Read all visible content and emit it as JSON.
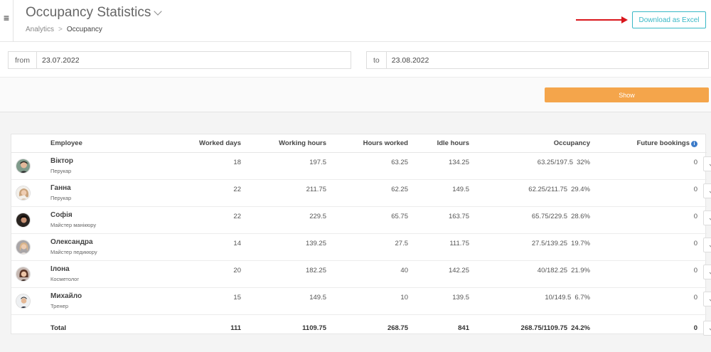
{
  "header": {
    "menu_icon": "hamburger-menu-icon",
    "title": "Occupancy Statistics",
    "breadcrumb": [
      "Analytics",
      "Occupancy"
    ],
    "download_label": "Download as Excel",
    "annotation_arrow_color": "#d9161c"
  },
  "filters": {
    "from_label": "from",
    "from_value": "23.07.2022",
    "to_label": "to",
    "to_value": "23.08.2022",
    "show_label": "Show",
    "accent_color": "#f4a54b"
  },
  "table": {
    "columns": {
      "employee": "Employee",
      "worked_days": "Worked days",
      "working_hours": "Working hours",
      "hours_worked": "Hours worked",
      "idle_hours": "Idle hours",
      "occupancy": "Occupancy",
      "future_bookings": "Future bookings"
    },
    "rows": [
      {
        "name": "Віктор",
        "role": "Перукар",
        "worked_days": "18",
        "working_hours": "197.5",
        "hours_worked": "63.25",
        "idle_hours": "134.25",
        "occupancy": "63.25/197.5",
        "occupancy_pct": "32%",
        "future_bookings": "0"
      },
      {
        "name": "Ганна",
        "role": "Перукар",
        "worked_days": "22",
        "working_hours": "211.75",
        "hours_worked": "62.25",
        "idle_hours": "149.5",
        "occupancy": "62.25/211.75",
        "occupancy_pct": "29.4%",
        "future_bookings": "0"
      },
      {
        "name": "Софія",
        "role": "Майстер манікюру",
        "worked_days": "22",
        "working_hours": "229.5",
        "hours_worked": "65.75",
        "idle_hours": "163.75",
        "occupancy": "65.75/229.5",
        "occupancy_pct": "28.6%",
        "future_bookings": "0"
      },
      {
        "name": "Олександра",
        "role": "Майстер педикюру",
        "worked_days": "14",
        "working_hours": "139.25",
        "hours_worked": "27.5",
        "idle_hours": "111.75",
        "occupancy": "27.5/139.25",
        "occupancy_pct": "19.7%",
        "future_bookings": "0"
      },
      {
        "name": "Ілона",
        "role": "Косметолог",
        "worked_days": "20",
        "working_hours": "182.25",
        "hours_worked": "40",
        "idle_hours": "142.25",
        "occupancy": "40/182.25",
        "occupancy_pct": "21.9%",
        "future_bookings": "0"
      },
      {
        "name": "Михайло",
        "role": "Тренер",
        "worked_days": "15",
        "working_hours": "149.5",
        "hours_worked": "10",
        "idle_hours": "139.5",
        "occupancy": "10/149.5",
        "occupancy_pct": "6.7%",
        "future_bookings": "0"
      }
    ],
    "total": {
      "label": "Total",
      "worked_days": "111",
      "working_hours": "1109.75",
      "hours_worked": "268.75",
      "idle_hours": "841",
      "occupancy": "268.75/1109.75",
      "occupancy_pct": "24.2%",
      "future_bookings": "0"
    }
  }
}
